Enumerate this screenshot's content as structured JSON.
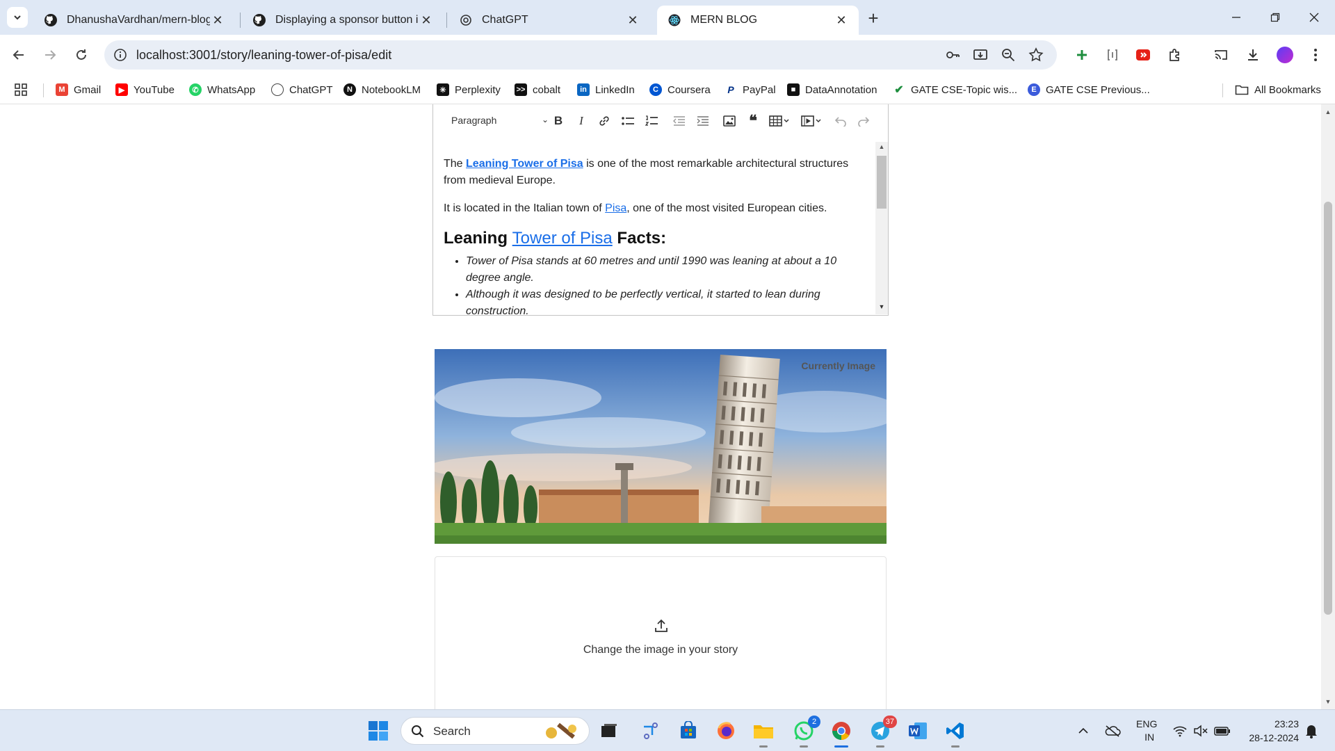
{
  "browser": {
    "tabs": [
      {
        "title": "DhanushaVardhan/mern-blog",
        "icon": "github-icon",
        "active": false
      },
      {
        "title": "Displaying a sponsor button in",
        "icon": "github-icon",
        "active": false
      },
      {
        "title": "ChatGPT",
        "icon": "chatgpt-icon",
        "active": false
      },
      {
        "title": "MERN BLOG",
        "icon": "react-icon",
        "active": true
      }
    ],
    "url": "localhost:3001/story/leaning-tower-of-pisa/edit",
    "bookmarks": [
      {
        "label": "Gmail",
        "color": "#ea4335"
      },
      {
        "label": "YouTube",
        "color": "#ff0000"
      },
      {
        "label": "WhatsApp",
        "color": "#25d366"
      },
      {
        "label": "ChatGPT",
        "color": "#444444"
      },
      {
        "label": "NotebookLM",
        "color": "#111111"
      },
      {
        "label": "Perplexity",
        "color": "#111111"
      },
      {
        "label": "cobalt",
        "color": "#111111"
      },
      {
        "label": "LinkedIn",
        "color": "#0a66c2"
      },
      {
        "label": "Coursera",
        "color": "#0056d2"
      },
      {
        "label": "PayPal",
        "color": "#003087"
      },
      {
        "label": "DataAnnotation",
        "color": "#111111"
      },
      {
        "label": "GATE CSE-Topic wis...",
        "color": "#1e8e3e"
      },
      {
        "label": "GATE CSE Previous...",
        "color": "#3b5bdb"
      }
    ],
    "all_bookmarks": "All Bookmarks"
  },
  "editor": {
    "block_format": "Paragraph",
    "para1_prefix": "The ",
    "para1_link": " Leaning Tower of Pisa",
    "para1_suffix": " is one of the most remarkable architectural structures from medieval Europe.",
    "para2_prefix": "It is located in the Italian town of ",
    "para2_link": "Pisa",
    "para2_suffix": ", one of the most visited European cities.",
    "heading_prefix": "Leaning ",
    "heading_link": " Tower of Pisa",
    "heading_suffix": " Facts:",
    "bullets": [
      "Tower of Pisa stands at 60 metres and until 1990 was leaning at about a 10 degree angle.",
      "Although it was designed to be perfectly vertical, it started to lean during construction."
    ]
  },
  "image_panel": {
    "label": "Currently Image"
  },
  "upload": {
    "text": "Change the image in your story"
  },
  "taskbar": {
    "search_placeholder": "Search",
    "whatsapp_badge": "2",
    "telegram_badge": "37",
    "lang_top": "ENG",
    "lang_bottom": "IN",
    "time": "23:23",
    "date": "28-12-2024"
  },
  "colors": {
    "link": "#1a6ee8",
    "tabstrip": "#dfe8f5",
    "taskbar_accent": "#1d6fe0"
  }
}
